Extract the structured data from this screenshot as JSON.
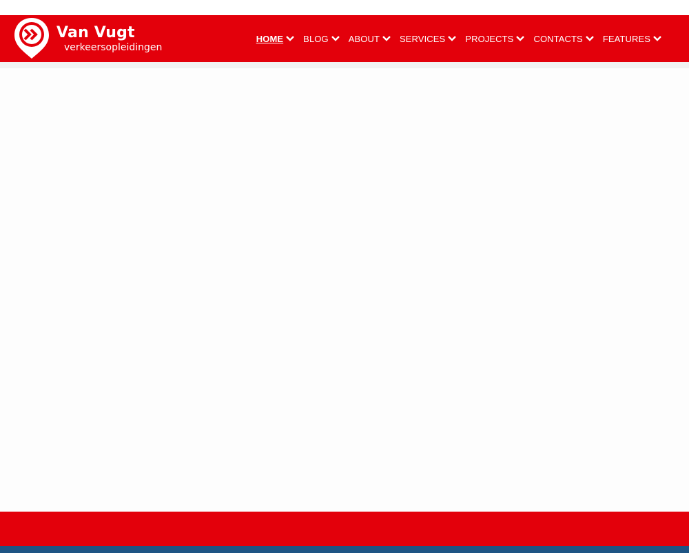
{
  "brand": {
    "name": "Van Vugt",
    "tagline": "verkeersopleidingen",
    "logo_icon": "double-chevron-pin-icon"
  },
  "nav": {
    "items": [
      {
        "label": "HOME",
        "active": true
      },
      {
        "label": "BLOG",
        "active": false
      },
      {
        "label": "ABOUT",
        "active": false
      },
      {
        "label": "SERVICES",
        "active": false
      },
      {
        "label": "PROJECTS",
        "active": false
      },
      {
        "label": "CONTACTS",
        "active": false
      },
      {
        "label": "FEATURES",
        "active": false
      }
    ],
    "dropdown_icon": "chevron-down-icon"
  },
  "colors": {
    "brand_red": "#e3000b",
    "footer_blue": "#1e5484",
    "text_on_red": "#ffffff"
  }
}
